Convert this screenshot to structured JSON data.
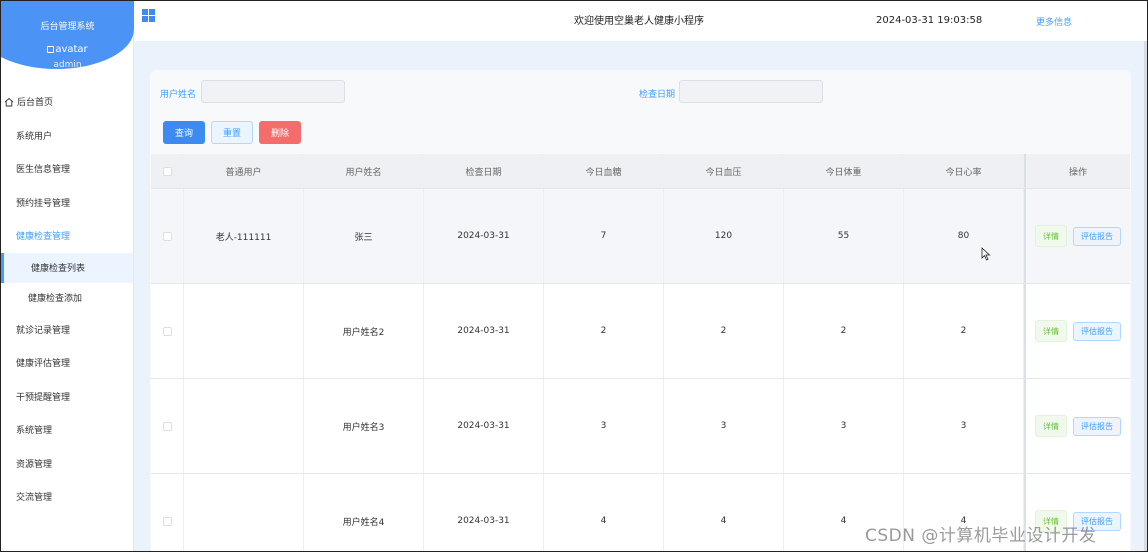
{
  "sidebar": {
    "brand_title": "后台管理系统",
    "avatar_alt": "avatar",
    "username": "admin",
    "home": "后台首页",
    "items": [
      {
        "label": "系统用户"
      },
      {
        "label": "医生信息管理"
      },
      {
        "label": "预约挂号管理"
      },
      {
        "label": "健康检查管理"
      }
    ],
    "subitems": [
      {
        "label": "健康检查列表"
      },
      {
        "label": "健康检查添加"
      }
    ],
    "items_after": [
      {
        "label": "就诊记录管理"
      },
      {
        "label": "健康评估管理"
      },
      {
        "label": "干预提醒管理"
      },
      {
        "label": "系统管理"
      },
      {
        "label": "资源管理"
      },
      {
        "label": "交流管理"
      }
    ]
  },
  "header": {
    "welcome": "欢迎使用空巢老人健康小程序",
    "datetime": "2024-03-31 19:03:58",
    "more": "更多信息"
  },
  "search": {
    "username_label": "用户姓名",
    "username_value": "",
    "date_label": "检查日期",
    "date_value": ""
  },
  "actions": {
    "query": "查询",
    "reset": "重置",
    "delete": "删除"
  },
  "table": {
    "columns": [
      "普通用户",
      "用户姓名",
      "检查日期",
      "今日血糖",
      "今日血压",
      "今日体重",
      "今日心率",
      "操作"
    ],
    "rows": [
      [
        "老人-111111",
        "张三",
        "2024-03-31",
        "7",
        "120",
        "55",
        "80"
      ],
      [
        "",
        "用户姓名2",
        "2024-03-31",
        "2",
        "2",
        "2",
        "2"
      ],
      [
        "",
        "用户姓名3",
        "2024-03-31",
        "3",
        "3",
        "3",
        "3"
      ],
      [
        "",
        "用户姓名4",
        "2024-03-31",
        "4",
        "4",
        "4",
        "4"
      ]
    ],
    "detail_label": "详情",
    "report_label": "评估报告"
  },
  "watermark": "CSDN @计算机毕业设计开发",
  "colors": {
    "primary": "#409eff",
    "brand": "#4b93f4",
    "danger": "#f56c6c",
    "success": "#67c23a"
  }
}
